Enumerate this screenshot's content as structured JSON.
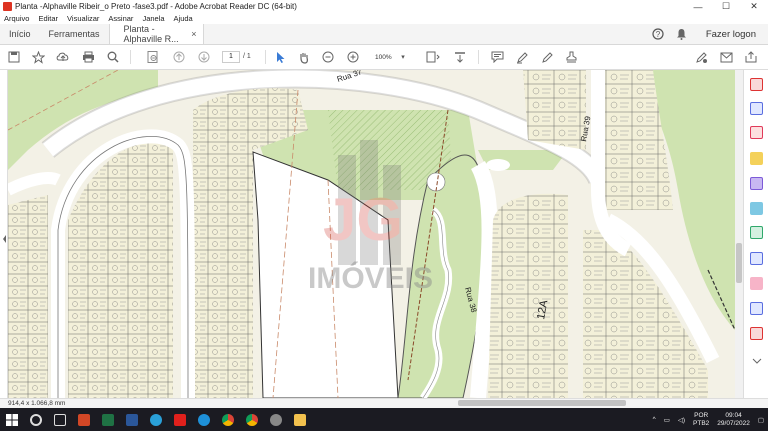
{
  "window": {
    "title": "Planta -Alphaville Ribeir_o Preto -fase3.pdf - Adobe Acrobat Reader DC (64-bit)",
    "minimize": "—",
    "maximize": "☐",
    "close": "✕"
  },
  "menu": [
    "Arquivo",
    "Editar",
    "Visualizar",
    "Assinar",
    "Janela",
    "Ajuda"
  ],
  "tabs": [
    {
      "label": "Início"
    },
    {
      "label": "Ferramentas"
    },
    {
      "label": "Planta -Alphaville R...",
      "close": "×"
    }
  ],
  "header": {
    "signin": "Fazer logon",
    "help_icon": "help-icon",
    "bell_icon": "bell-icon"
  },
  "toolbar": {
    "page_current": "1",
    "page_total": "/ 1",
    "zoom": "100%"
  },
  "map": {
    "streets": [
      "Rua 37",
      "Rua 39",
      "Rua 38"
    ],
    "block": "12A",
    "watermark": "IMÓVEIS"
  },
  "status": {
    "dimensions": "914,4 x 1.066,8 mm"
  },
  "taskbar": {
    "lang_top": "POR",
    "lang_bottom": "PTB2",
    "time": "09:04",
    "date": "29/07/2022"
  },
  "colors": {
    "paper": "#f3f1e6",
    "green": "#cfe3b0",
    "lot_line": "#555555",
    "boundary": "#c98a6a"
  }
}
